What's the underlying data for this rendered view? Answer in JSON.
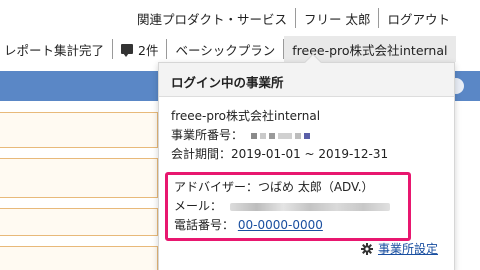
{
  "topnav": {
    "items": [
      "関連プロダクト・サービス",
      "フリー 太郎",
      "ログアウト"
    ]
  },
  "subnav": {
    "report_label": "レポート集計完了",
    "messages_count": "2件",
    "plan_label": "ベーシックプラン",
    "office_label": "freee-pro株式会社internal"
  },
  "popover": {
    "title": "ログイン中の事業所",
    "company_name": "freee-pro株式会社internal",
    "office_number_label": "事業所番号：",
    "fiscal_period": "会計期間：2019-01-01 ~ 2019-12-31",
    "advisor": {
      "label": "アドバイザー：つばめ 太郎（ADV.）",
      "mail_label": "メール：",
      "phone_label": "電話番号：",
      "phone_value": "00-0000-0000"
    },
    "settings_link": "事業所設定"
  },
  "icons": {
    "messages": "chat-bubble-icon",
    "settings": "gear-icon"
  },
  "colors": {
    "band": "#5a87c6",
    "highlight": "#e8176f",
    "link": "#1a4fa0",
    "card_border": "#e8b97a"
  }
}
